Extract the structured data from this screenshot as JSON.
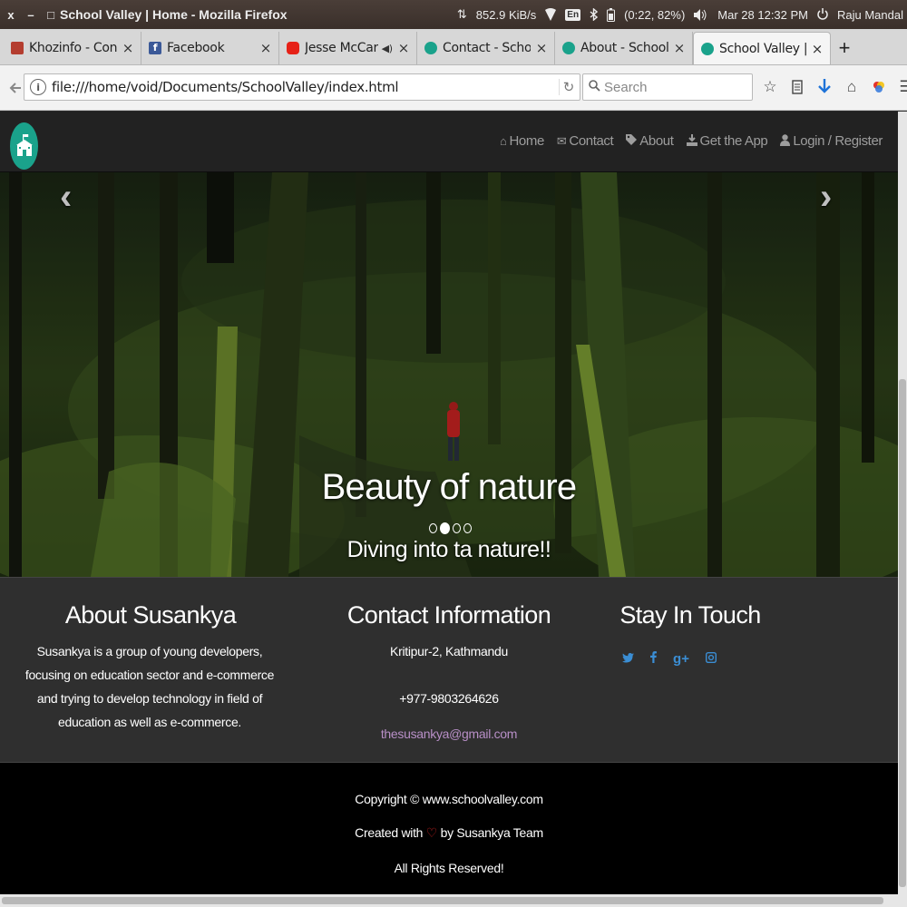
{
  "os_bar": {
    "window_controls": [
      "x",
      "–",
      "□"
    ],
    "title": "School Valley | Home - Mozilla Firefox",
    "net_speed": "852.9 KiB/s",
    "keyboard": "En",
    "battery": "(0:22, 82%)",
    "datetime": "Mar 28 12:32 PM",
    "user": "Raju Mandal"
  },
  "tabs": [
    {
      "label": "Khozinfo - Contact",
      "favicon_color": "#b43d2f",
      "close": "×"
    },
    {
      "label": "Facebook",
      "favicon_color": "#3b5998",
      "close": "×"
    },
    {
      "label": "Jesse McCartney...",
      "favicon_color": "#e62117",
      "close": "×"
    },
    {
      "label": "Contact - SchoolValley",
      "favicon_color": "#1aa28b",
      "close": "×"
    },
    {
      "label": "About - SchoolValley",
      "favicon_color": "#1aa28b",
      "close": "×"
    },
    {
      "label": "School Valley | Home",
      "favicon_color": "#1aa28b",
      "close": "×",
      "active": true
    }
  ],
  "new_tab": "+",
  "nav": {
    "url": "file:///home/void/Documents/SchoolValley/index.html",
    "search_placeholder": "Search"
  },
  "site": {
    "menu": {
      "home": "Home",
      "contact": "Contact",
      "about": "About",
      "get_app": "Get the App",
      "login": "Login / Register"
    },
    "carousel": {
      "title": "Beauty of nature",
      "subtitle": "Diving into ta nature!!",
      "slides": 4,
      "active_slide": 2,
      "prev": "‹",
      "next": "›"
    },
    "about": {
      "heading": "About Susankya",
      "text": "Susankya is a group of young developers, focusing on education sector and e-commerce and trying to develop technology in field of education as well as e-commerce."
    },
    "contact": {
      "heading": "Contact Information",
      "address": "Kritipur-2, Kathmandu",
      "phone": "+977-9803264626",
      "email": "thesusankya@gmail.com"
    },
    "stay_in_touch": {
      "heading": "Stay In Touch",
      "icons": [
        "twitter-icon",
        "facebook-icon",
        "google-plus-icon",
        "instagram-icon"
      ]
    },
    "footer": {
      "copyright": "Copyright © www.schoolvalley.com",
      "created_prefix": "Created with",
      "created_suffix": "by Susankya Team",
      "rights": "All Rights Reserved!"
    }
  },
  "colors": {
    "accent": "#1aa28b",
    "link": "#b88fc7",
    "social": "#3b8ed4"
  }
}
